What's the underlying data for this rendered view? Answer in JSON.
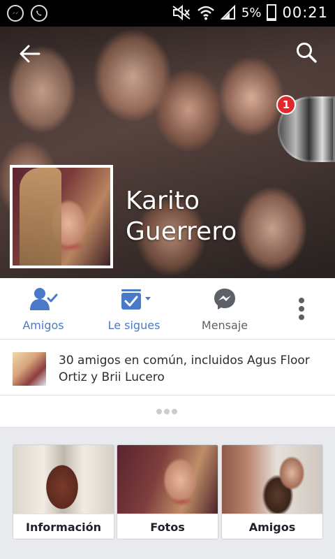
{
  "status_bar": {
    "battery": "5%",
    "time": "00:21",
    "icons": [
      "messenger-icon",
      "whatsapp-icon",
      "mute-icon",
      "wifi-icon",
      "signal-icon",
      "battery-icon"
    ]
  },
  "cover": {
    "back_icon": "arrow-left-icon",
    "search_icon": "search-icon",
    "chat_head_badge": "1"
  },
  "profile": {
    "name_first": "Karito",
    "name_last": "Guerrero"
  },
  "actions": [
    {
      "label": "Amigos",
      "icon": "friends-check-icon",
      "color": "#4a79c9"
    },
    {
      "label": "Le sigues",
      "icon": "following-icon",
      "color": "#4a79c9"
    },
    {
      "label": "Mensaje",
      "icon": "messenger-icon",
      "color": "#5d6167"
    }
  ],
  "mutual_friends": {
    "text": "30 amigos en común, incluidos Agus Floor Ortiz y Brii Lucero"
  },
  "cards": [
    {
      "label": "Información"
    },
    {
      "label": "Fotos"
    },
    {
      "label": "Amigos"
    }
  ],
  "colors": {
    "accent": "#4a79c9",
    "badge": "#e0282e"
  }
}
